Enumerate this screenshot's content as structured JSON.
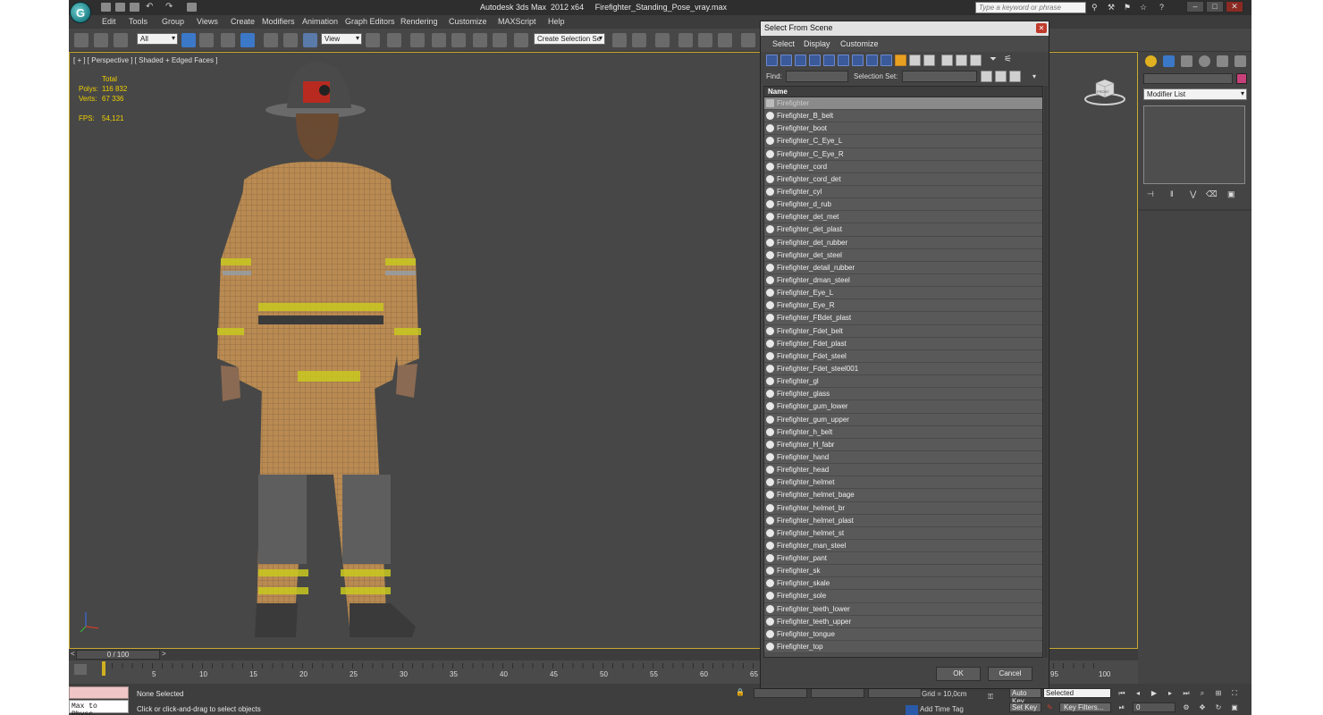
{
  "window": {
    "title": "Autodesk 3ds Max  2012 x64     Firefighter_Standing_Pose_vray.max",
    "search_placeholder": "Type a keyword or phrase",
    "logo_glyph": "G"
  },
  "menu": [
    "Edit",
    "Tools",
    "Group",
    "Views",
    "Create",
    "Modifiers",
    "Animation",
    "Graph Editors",
    "Rendering",
    "Customize",
    "MAXScript",
    "Help"
  ],
  "toolbar": {
    "selection_filter": "All",
    "ref_coord": "View",
    "named_selection": "Create Selection Se"
  },
  "viewport": {
    "label": "[ + ] [ Perspective ] [ Shaded + Edged Faces ]",
    "stats": {
      "header": "Total",
      "polys_label": "Polys:",
      "polys_value": "116 832",
      "verts_label": "Verts:",
      "verts_value": "67 336",
      "fps_label": "FPS:",
      "fps_value": "54,121"
    },
    "viewcube_label": "FRONT"
  },
  "dialog": {
    "title": "Select From Scene",
    "menu": [
      "Select",
      "Display",
      "Customize"
    ],
    "find_label": "Find:",
    "selection_set_label": "Selection Set:",
    "column_header": "Name",
    "items": [
      "Firefighter",
      "Firefighter_B_belt",
      "Firefighter_boot",
      "Firefighter_C_Eye_L",
      "Firefighter_C_Eye_R",
      "Firefighter_cord",
      "Firefighter_cord_det",
      "Firefighter_cyl",
      "Firefighter_d_rub",
      "Firefighter_det_met",
      "Firefighter_det_plast",
      "Firefighter_det_rubber",
      "Firefighter_det_steel",
      "Firefighter_detail_rubber",
      "Firefighter_dman_steel",
      "Firefighter_Eye_L",
      "Firefighter_Eye_R",
      "Firefighter_FBdet_plast",
      "Firefighter_Fdet_belt",
      "Firefighter_Fdet_plast",
      "Firefighter_Fdet_steel",
      "Firefighter_Fdet_steel001",
      "Firefighter_gl",
      "Firefighter_glass",
      "Firefighter_gum_lower",
      "Firefighter_gum_upper",
      "Firefighter_h_belt",
      "Firefighter_H_fabr",
      "Firefighter_hand",
      "Firefighter_head",
      "Firefighter_helmet",
      "Firefighter_helmet_bage",
      "Firefighter_helmet_br",
      "Firefighter_helmet_plast",
      "Firefighter_helmet_st",
      "Firefighter_man_steel",
      "Firefighter_pant",
      "Firefighter_sk",
      "Firefighter_skale",
      "Firefighter_sole",
      "Firefighter_teeth_lower",
      "Firefighter_teeth_upper",
      "Firefighter_tongue",
      "Firefighter_top"
    ],
    "ok_label": "OK",
    "cancel_label": "Cancel"
  },
  "command_panel": {
    "modifier_list": "Modifier List",
    "color": "#c8407a"
  },
  "timeline": {
    "frame_display": "0 / 100",
    "ticks": [
      "5",
      "10",
      "15",
      "20",
      "25",
      "30",
      "35",
      "40",
      "45",
      "50",
      "55",
      "60",
      "65",
      "95",
      "100"
    ]
  },
  "status": {
    "maxscript_label": "Max to Physc.",
    "selection_status": "None Selected",
    "prompt": "Click or click-and-drag to select objects",
    "grid_text": "Grid = 10,0cm",
    "auto_key": "Auto Key",
    "selected_dropdown": "Selected",
    "set_key": "Set Key",
    "key_filters": "Key Filters...",
    "add_time_tag": "Add Time Tag",
    "current_frame": "0"
  }
}
